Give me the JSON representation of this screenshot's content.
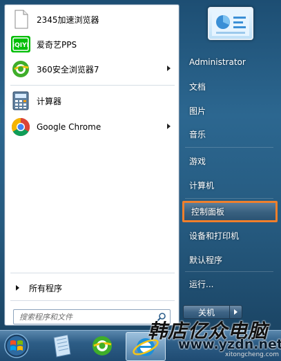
{
  "programs": [
    {
      "label": "2345加速浏览器",
      "icon": "blank-page-icon",
      "has_submenu": false
    },
    {
      "label": "爱奇艺PPS",
      "icon": "iqiyi-icon",
      "has_submenu": false
    },
    {
      "label": "360安全浏览器7",
      "icon": "360-browser-icon",
      "has_submenu": true
    },
    {
      "label": "计算器",
      "icon": "calculator-icon",
      "has_submenu": false
    },
    {
      "label": "Google Chrome",
      "icon": "chrome-icon",
      "has_submenu": true
    }
  ],
  "all_programs_label": "所有程序",
  "search": {
    "placeholder": "搜索程序和文件"
  },
  "right_pane": {
    "user": "Administrator",
    "items": [
      "文档",
      "图片",
      "音乐",
      "游戏",
      "计算机",
      "控制面板",
      "设备和打印机",
      "默认程序",
      "运行..."
    ],
    "highlighted": "控制面板"
  },
  "shutdown_label": "关机",
  "taskbar": {
    "items": [
      "start-orb-icon",
      "notepad-icon",
      "360-browser-icon",
      "ie-icon"
    ]
  },
  "watermark": {
    "brand": "韩店亿众电脑",
    "url": "www.yzdn.net",
    "sub": "xitongcheng.com"
  },
  "colors": {
    "highlight_border": "#f07f2b",
    "iqiyi_green": "#00be06",
    "ie_blue": "#1e90d9"
  }
}
